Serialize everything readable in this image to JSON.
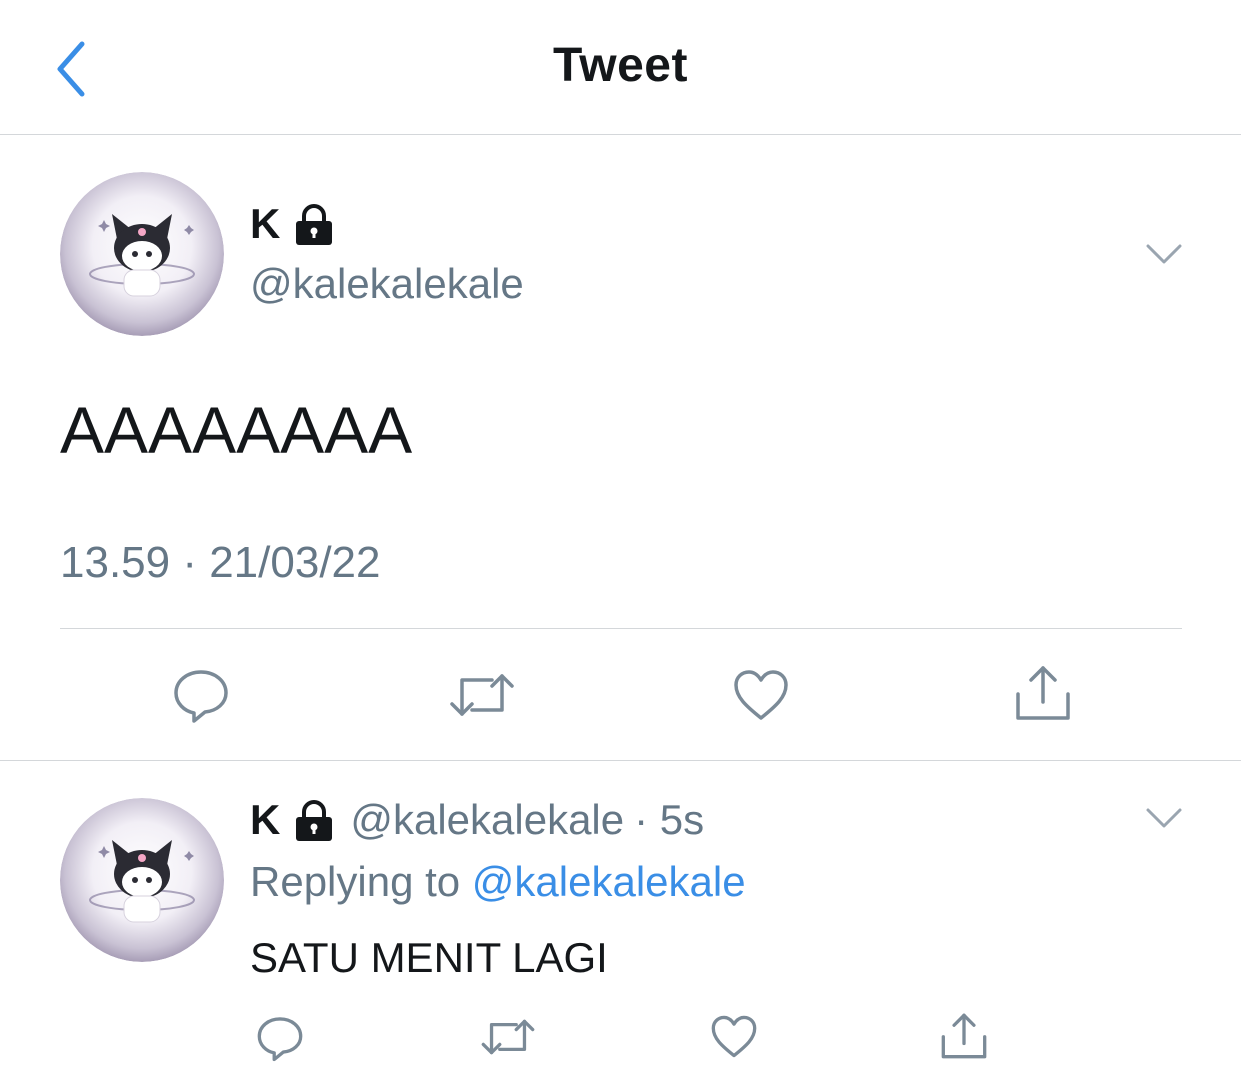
{
  "nav": {
    "title": "Tweet"
  },
  "main_tweet": {
    "name": "K",
    "handle": "@kalekalekale",
    "text": "AAAAAAAA",
    "timestamp": "13.59 · 21/03/22"
  },
  "reply": {
    "name": "K",
    "handle": "@kalekalekale",
    "age": "· 5s",
    "replying_prefix": "Replying to",
    "replying_to": "@kalekalekale",
    "text": "SATU MENIT LAGI"
  },
  "colors": {
    "accent": "#3a8ee6",
    "secondary_text": "#657786",
    "icon_gray": "#7b8a97",
    "divider": "#d4d7da"
  },
  "icons": [
    "chevron-left-icon",
    "lock-icon",
    "chevron-down-icon",
    "reply-icon",
    "retweet-icon",
    "like-icon",
    "share-icon"
  ]
}
